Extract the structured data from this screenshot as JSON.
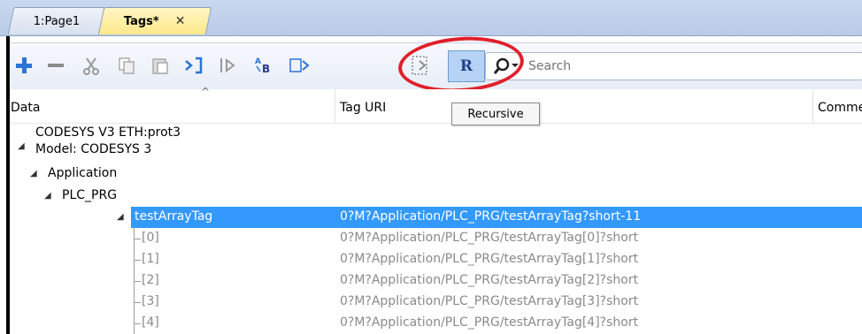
{
  "tabs": [
    {
      "label": "1:Page1"
    },
    {
      "label": "Tags*",
      "close": "✕"
    }
  ],
  "toolbar": {
    "recursive_label": "R",
    "search_placeholder": "Search",
    "tooltip": "Recursive",
    "icons": [
      "add-icon",
      "remove-icon",
      "cut-icon",
      "copy-icon",
      "paste-icon",
      "import-icon",
      "export-icon",
      "rename-icon",
      "find-replace-icon",
      "sync-icon",
      "recursive-icon",
      "search-icon"
    ]
  },
  "columns": {
    "data": "Data",
    "tag_uri": "Tag URI",
    "comment": "Comment"
  },
  "tree": {
    "root_line1": "CODESYS V3 ETH:prot3",
    "root_line2": "Model: CODESYS 3",
    "application": "Application",
    "plc_prg": "PLC_PRG",
    "selected": {
      "label": "testArrayTag",
      "uri": "0?M?Application/PLC_PRG/testArrayTag?short-11"
    },
    "items": [
      {
        "label": "[0]",
        "uri": "0?M?Application/PLC_PRG/testArrayTag[0]?short"
      },
      {
        "label": "[1]",
        "uri": "0?M?Application/PLC_PRG/testArrayTag[1]?short"
      },
      {
        "label": "[2]",
        "uri": "0?M?Application/PLC_PRG/testArrayTag[2]?short"
      },
      {
        "label": "[3]",
        "uri": "0?M?Application/PLC_PRG/testArrayTag[3]?short"
      },
      {
        "label": "[4]",
        "uri": "0?M?Application/PLC_PRG/testArrayTag[4]?short"
      }
    ]
  },
  "colors": {
    "selection": "#3399ff",
    "highlight_ring": "#e0202a",
    "toggle_active": "#b6d3f6"
  }
}
